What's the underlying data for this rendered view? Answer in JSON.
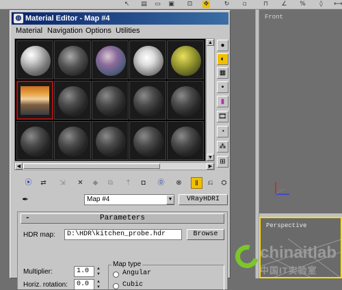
{
  "editor": {
    "title": "Material Editor - Map #4",
    "menus": [
      "Material",
      "Navigation",
      "Options",
      "Utilities"
    ],
    "map_name": "Map #4",
    "map_type_button": "VRayHDRI",
    "parameters_rollout": "Parameters",
    "rollout_toggle": "-",
    "hdr_map_label": "HDR map:",
    "hdr_map_path": "D:\\HDR\\kitchen_probe.hdr",
    "browse_label": "Browse",
    "multiplier_label": "Multiplier:",
    "multiplier_value": "1.0",
    "horiz_rotation_label": "Horiz. rotation:",
    "horiz_rotation_value": "0.0",
    "map_type_group_label": "Map type",
    "map_type_options": [
      "Angular",
      "Cubic"
    ]
  },
  "viewports": {
    "front_label": "Front",
    "perspective_label": "Perspective"
  },
  "watermark": {
    "brand": "chinaitlab",
    "subtitle": "中国IT实验室"
  },
  "colors": {
    "selected_slot_border": "#b01010",
    "active_tool": "#f0c000",
    "active_viewport_border": "#ffe000",
    "titlebar": "#0a246a"
  },
  "icons": {
    "right_toolbar": [
      "sample-type-icon",
      "backlight-icon",
      "background-icon",
      "uv-tiling-icon",
      "video-color-check-icon",
      "make-preview-icon",
      "options-icon",
      "select-by-material-icon",
      "material-map-navigator-icon"
    ],
    "bottom_toolbar": [
      "get-material-icon",
      "put-to-scene-icon",
      "assign-material-icon",
      "reset-map-icon",
      "make-copy-icon",
      "make-unique-icon",
      "put-to-library-icon",
      "material-id-channel-icon",
      "show-map-in-viewport-icon",
      "show-end-result-icon",
      "go-to-parent-icon",
      "go-forward-to-sibling-icon"
    ]
  }
}
